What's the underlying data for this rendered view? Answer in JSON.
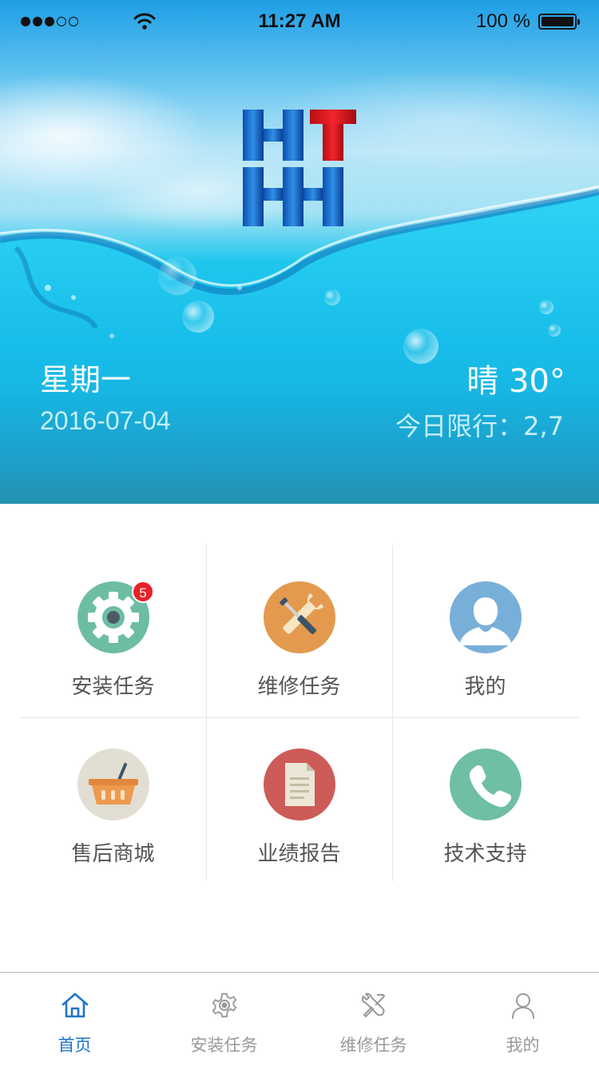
{
  "status_bar": {
    "time": "11:27 AM",
    "battery": "100 %"
  },
  "hero": {
    "logo_text": "HHT",
    "weekday": "星期一",
    "date": "2016-07-04",
    "weather": "晴 30°",
    "restriction": "今日限行：2,7"
  },
  "menu": {
    "items": [
      {
        "label": "安装任务",
        "icon": "gear-icon",
        "color": "#6dbda4",
        "badge": "5"
      },
      {
        "label": "维修任务",
        "icon": "tools-icon",
        "color": "#e49a4e"
      },
      {
        "label": "我的",
        "icon": "user-icon",
        "color": "#78afd9"
      },
      {
        "label": "售后商城",
        "icon": "basket-icon",
        "color": "#e2ded3"
      },
      {
        "label": "业绩报告",
        "icon": "document-icon",
        "color": "#cd5b58"
      },
      {
        "label": "技术支持",
        "icon": "phone-icon",
        "color": "#6fbea6"
      }
    ]
  },
  "tab_bar": {
    "tabs": [
      {
        "label": "首页",
        "icon": "home-icon",
        "active": true
      },
      {
        "label": "安装任务",
        "icon": "gear-icon"
      },
      {
        "label": "维修任务",
        "icon": "tools-icon"
      },
      {
        "label": "我的",
        "icon": "user-icon"
      }
    ],
    "active_color": "#1f74c8",
    "inactive_color": "#9a9a9a"
  }
}
